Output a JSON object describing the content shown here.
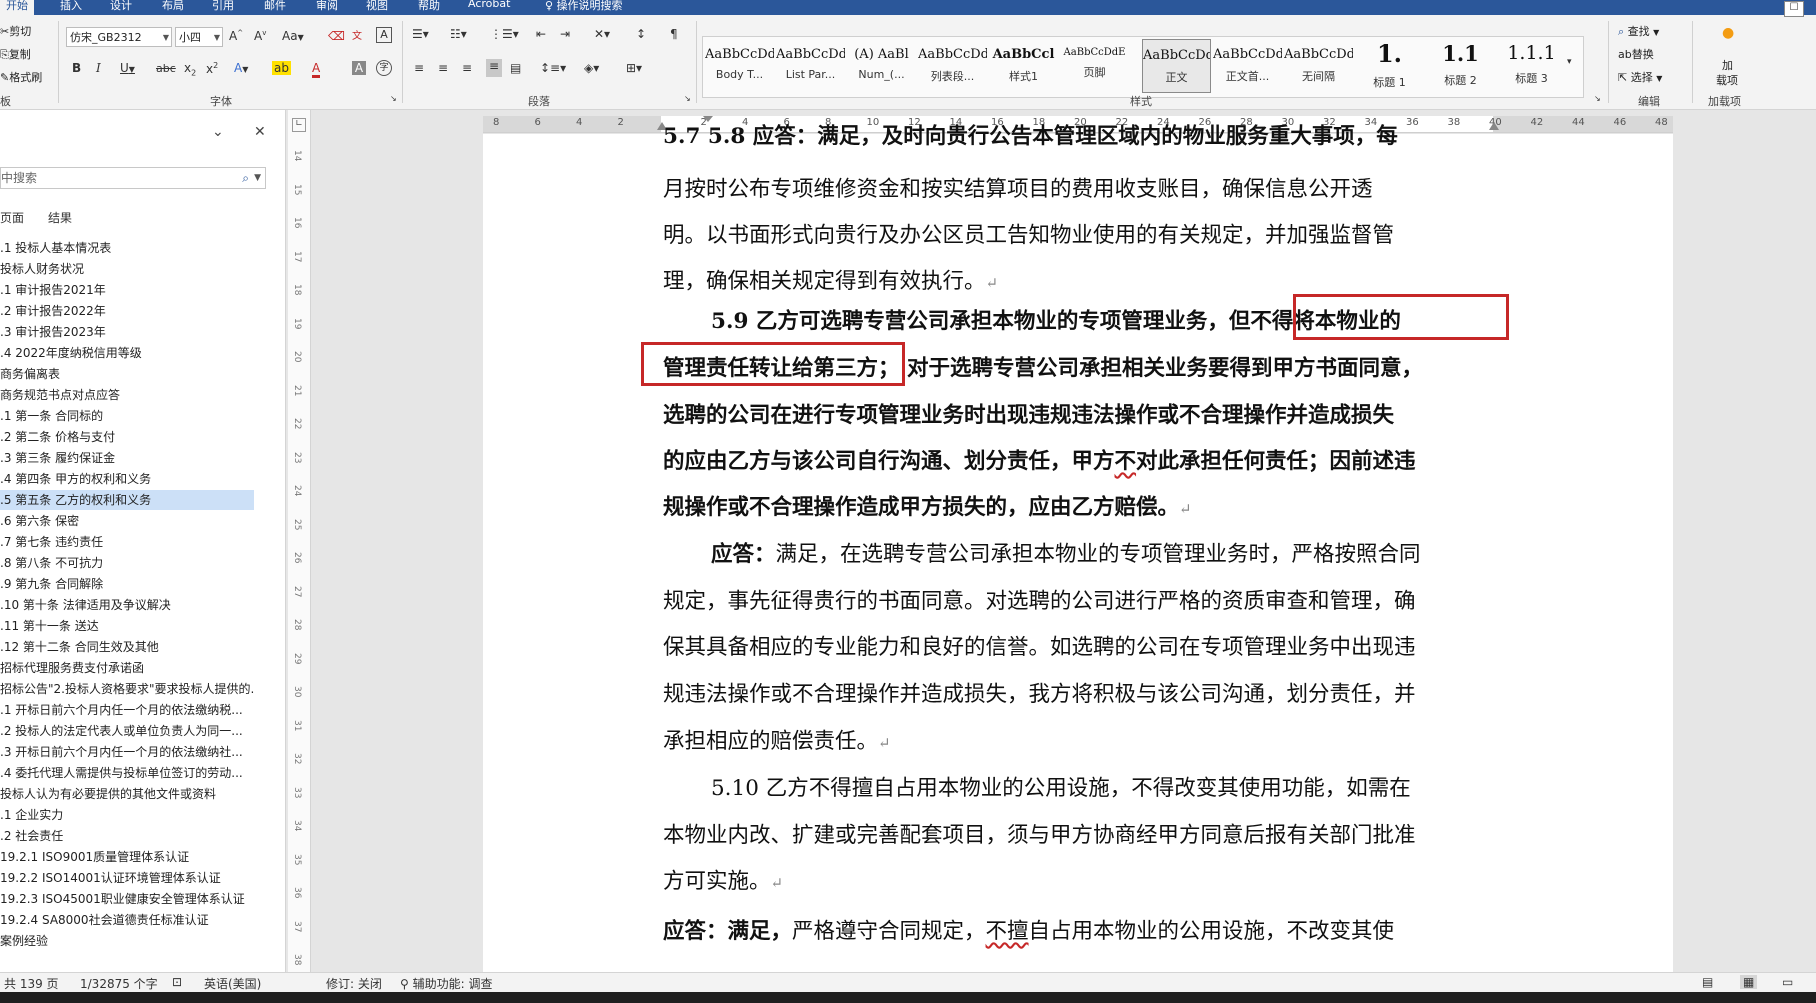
{
  "ribbon_tabs": [
    "开始",
    "插入",
    "设计",
    "布局",
    "引用",
    "邮件",
    "审阅",
    "视图",
    "帮助",
    "Acrobat",
    "操作说明搜索"
  ],
  "clipboard": {
    "cut": "剪切",
    "copy": "复制",
    "format_painter": "格式刷",
    "label": "板"
  },
  "font": {
    "name": "仿宋_GB2312",
    "size": "小四",
    "label": "字体",
    "change_case": "Aa",
    "wen": "文",
    "A": "A"
  },
  "paragraph": {
    "label": "段落"
  },
  "styles": {
    "label": "样式",
    "items": [
      {
        "sample": "AaBbCcDd",
        "name": "Body T..."
      },
      {
        "sample": "AaBbCcDd",
        "name": "List Par..."
      },
      {
        "sample": "(A) AaBl",
        "name": "Num_(..."
      },
      {
        "sample": "AaBbCcDd",
        "name": "列表段..."
      },
      {
        "sample": "AaBbCcl",
        "name": "样式1"
      },
      {
        "sample": "AaBbCcDdE",
        "name": "页脚"
      },
      {
        "sample": "AaBbCcDd",
        "name": "正文"
      },
      {
        "sample": "AaBbCcDd",
        "name": "正文首..."
      },
      {
        "sample": "AaBbCcDd",
        "name": "无间隔"
      },
      {
        "sample": "1.",
        "name": "标题 1"
      },
      {
        "sample": "1.1",
        "name": "标题 2"
      },
      {
        "sample": "1.1.1",
        "name": "标题 3"
      }
    ]
  },
  "editing": {
    "find": "查找",
    "replace": "替换",
    "select": "选择",
    "label": "编辑"
  },
  "addins": {
    "load": "加",
    "load2": "载项",
    "label": "加载项"
  },
  "nav": {
    "search_placeholder": "中搜索",
    "tabs": [
      "页面",
      "结果"
    ],
    "items": [
      ".1 投标人基本情况表",
      "投标人财务状况",
      ".1 审计报告2021年",
      ".2 审计报告2022年",
      ".3 审计报告2023年",
      ".4 2022年度纳税信用等级",
      "商务偏离表",
      "商务规范书点对点应答",
      ".1 第一条 合同标的",
      ".2 第二条 价格与支付",
      ".3 第三条 履约保证金",
      ".4 第四条 甲方的权利和义务",
      ".5 第五条 乙方的权利和义务",
      ".6 第六条 保密",
      ".7 第七条 违约责任",
      ".8 第八条 不可抗力",
      ".9 第九条 合同解除",
      ".10 第十条 法律适用及争议解决",
      ".11 第十一条 送达",
      ".12 第十二条 合同生效及其他",
      "招标代理服务费支付承诺函",
      "招标公告\"2.投标人资格要求\"要求投标人提供的...",
      ".1 开标日前六个月内任一个月的依法缴纳税...",
      ".2 投标人的法定代表人或单位负责人为同一...",
      ".3 开标日前六个月内任一个月的依法缴纳社...",
      ".4 委托代理人需提供与投标单位签订的劳动...",
      "投标人认为有必要提供的其他文件或资料",
      ".1 企业实力",
      ".2 社会责任",
      "19.2.1 ISO9001质量管理体系认证",
      "19.2.2 ISO14001认证环境管理体系认证",
      "19.2.3 ISO45001职业健康安全管理体系认证",
      "19.2.4 SA8000社会道德责任标准认证",
      "案例经验"
    ]
  },
  "document": {
    "p0": "5.7 5.8 应答：满足，及时向贵行公告本管理区域内的物业服务重大事项，每",
    "p1": "月按时公布专项维修资金和按实结算项目的费用收支账目，确保信息公开透",
    "p2": "明。以书面形式向贵行及办公区员工告知物业使用的有关规定，并加强监督管",
    "p3": "理，确保相关规定得到有效执行。",
    "p4a": "5.9  乙方可选聘专营公司承担本物业的专项管理业务，",
    "p4b": "但不得将本物业的",
    "p5a": "管理责任转让给第三方；",
    "p5b": "对于选聘专营公司承担相关业务要得到甲方书面同意，",
    "p6": "选聘的公司在进行专项管理业务时出现违规违法操作或不合理操作并造成损失",
    "p7a": "的应由乙方与该公司自行沟通、划分责任，甲方",
    "p7b": "不",
    "p7c": "对此承担任何责任；因前述违",
    "p8": "规操作或不合理操作造成甲方损失的，应由乙方赔偿。",
    "p9a": "应答：",
    "p9b": "满足，在选聘专营公司承担本物业的专项管理业务时，严格按照合同",
    "p10": "规定，事先征得贵行的书面同意。对选聘的公司进行严格的资质审查和管理，确",
    "p11": "保其具备相应的专业能力和良好的信誉。如选聘的公司在专项管理业务中出现违",
    "p12": "规违法操作或不合理操作并造成损失，我方将积极与该公司沟通，划分责任，并",
    "p13": "承担相应的赔偿责任。",
    "p14": "5.10  乙方不得擅自占用本物业的公用设施，不得改变其使用功能，如需在",
    "p15": "本物业内改、扩建或完善配套项目，须与甲方协商经甲方同意后报有关部门批准",
    "p16": "方可实施。",
    "p17a": "应答：满足，",
    "p17b": "严格遵守合同规定，",
    "p17c": "不擅",
    "p17d": "自占用本物业的公用设施，不改变其使",
    "para_mark": "↵"
  },
  "status": {
    "pages": "共 139 页",
    "words": "1/32875 个字",
    "lang": "英语(美国)",
    "track": "修订: 关闭",
    "access": "辅助功能: 调查"
  },
  "colors": {
    "accent": "#2b579a",
    "highlight_box": "#c62828",
    "nav_selected": "#cce0f7"
  }
}
